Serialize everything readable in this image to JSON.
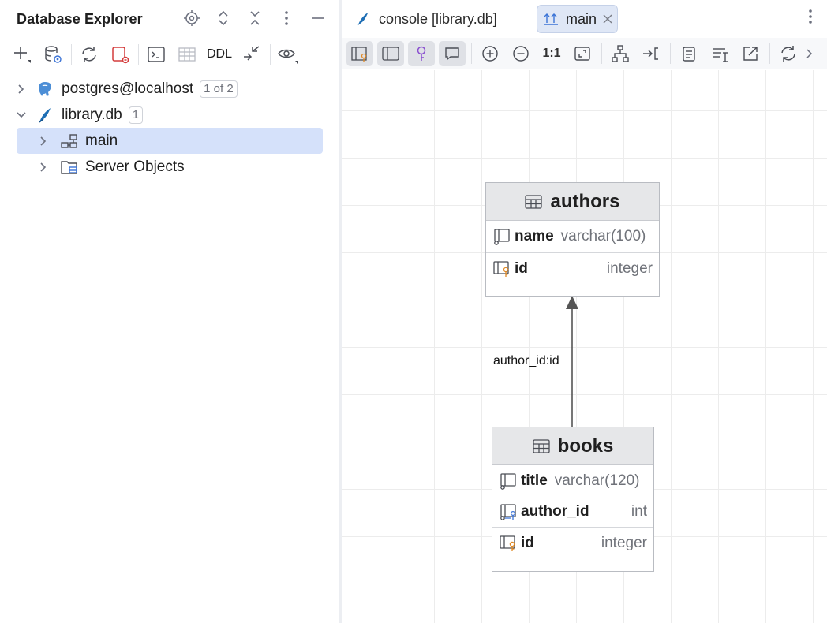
{
  "explorer": {
    "title": "Database Explorer",
    "ddl_label": "DDL",
    "tree": [
      {
        "label": "postgres@localhost",
        "badge": "1 of 2"
      },
      {
        "label": "library.db",
        "badge": "1"
      },
      {
        "label": "main"
      },
      {
        "label": "Server Objects"
      }
    ]
  },
  "editor": {
    "tabs": [
      {
        "label": "console [library.db]"
      },
      {
        "label": "main"
      }
    ],
    "toolbar": {
      "actual_size_label": "1:1"
    }
  },
  "diagram": {
    "entities": [
      {
        "name": "authors",
        "columns": [
          {
            "name": "name",
            "type": "varchar(100)"
          },
          {
            "name": "id",
            "type": "integer"
          }
        ]
      },
      {
        "name": "books",
        "columns": [
          {
            "name": "title",
            "type": "varchar(120)"
          },
          {
            "name": "author_id",
            "type": "int"
          },
          {
            "name": "id",
            "type": "integer"
          }
        ]
      }
    ],
    "relation_label": "author_id:id"
  },
  "colors": {
    "selection": "#d5e1fa",
    "active_tab": "#dfe7f6",
    "entity_header": "#e6e7e9",
    "key_orange": "#e08a27",
    "fk_blue": "#3b73d6",
    "sqlite_blue": "#1f6fb5"
  }
}
